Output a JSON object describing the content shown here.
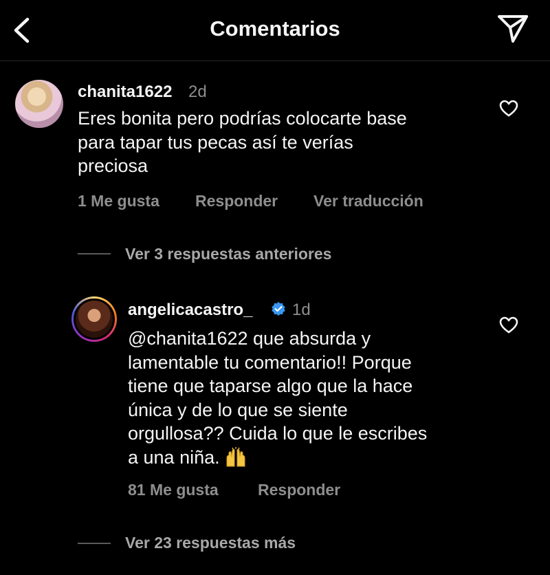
{
  "header": {
    "title": "Comentarios",
    "back_icon": "chevron-left-icon",
    "send_icon": "paper-plane-icon"
  },
  "comment": {
    "username": "chanita1622",
    "time": "2d",
    "text_lines": [
      "Eres bonita pero podrías colocarte base",
      "para tapar tus pecas así te verías",
      "preciosa"
    ],
    "likes": "1 Me gusta",
    "reply": "Responder",
    "translate": "Ver traducción"
  },
  "previous_replies": "Ver 3 respuestas anteriores",
  "reply": {
    "username": "angelicacastro_",
    "time": "1d",
    "verified": true,
    "text_lines": [
      "@chanita1622 que absurda y",
      "lamentable tu comentario!! Porque",
      "tiene que taparse algo que la hace",
      "única y de lo que se siente",
      "orgullosa?? Cuida lo que le escribes",
      "a una niña."
    ],
    "emoji": "raised-hands-icon",
    "likes": "81 Me gusta",
    "reply": "Responder"
  },
  "more_replies": "Ver 23 respuestas más",
  "colors": {
    "background": "#000000",
    "text": "#f5f5f5",
    "muted": "#8e8e8e",
    "verified": "#3897f0"
  }
}
